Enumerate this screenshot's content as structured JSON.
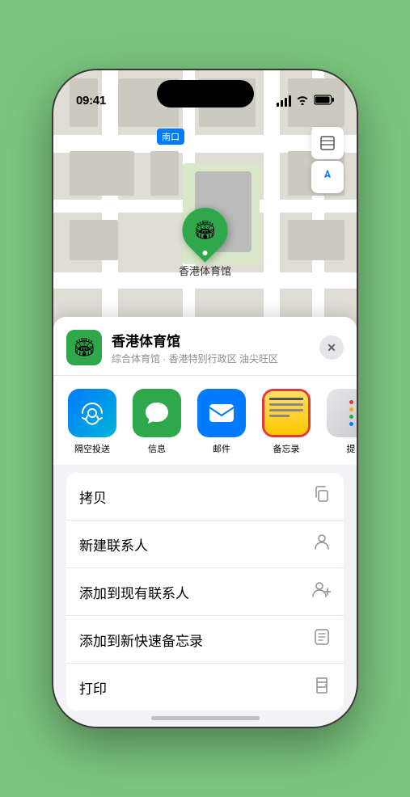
{
  "phone": {
    "status_bar": {
      "time": "09:41",
      "location_arrow": "▶"
    }
  },
  "map": {
    "label": "南口",
    "marker_label": "香港体育馆",
    "controls": {
      "layers_icon": "🗺",
      "location_icon": "↗"
    }
  },
  "bottom_sheet": {
    "venue_icon": "🏟",
    "venue_name": "香港体育馆",
    "venue_sub": "综合体育馆 · 香港特别行政区 油尖旺区",
    "close_label": "✕",
    "share_items": [
      {
        "id": "airdrop",
        "label": "隔空投送",
        "type": "airdrop"
      },
      {
        "id": "messages",
        "label": "信息",
        "type": "messages"
      },
      {
        "id": "mail",
        "label": "邮件",
        "type": "mail"
      },
      {
        "id": "notes",
        "label": "备忘录",
        "type": "notes"
      },
      {
        "id": "more",
        "label": "提",
        "type": "more"
      }
    ],
    "action_items": [
      {
        "label": "拷贝",
        "icon": "copy"
      },
      {
        "label": "新建联系人",
        "icon": "person"
      },
      {
        "label": "添加到现有联系人",
        "icon": "person-add"
      },
      {
        "label": "添加到新快速备忘录",
        "icon": "note"
      },
      {
        "label": "打印",
        "icon": "print"
      }
    ]
  },
  "colors": {
    "green": "#2ea84b",
    "blue": "#007aff",
    "red": "#e53935",
    "gray": "#8e8e93"
  }
}
